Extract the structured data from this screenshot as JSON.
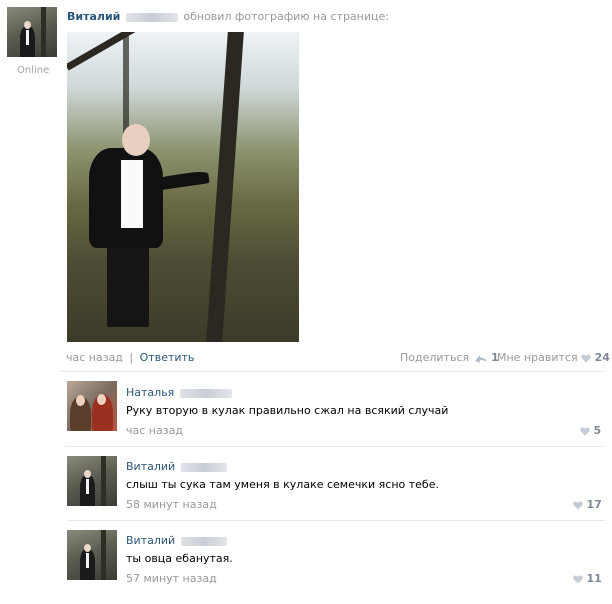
{
  "post": {
    "author_name": "Виталий",
    "action_text": "обновил фотографию на странице:",
    "status": "Online",
    "time": "час назад",
    "separator": "|",
    "reply_label": "Ответить",
    "share_label": "Поделиться",
    "share_count": "1",
    "like_label": "Мне нравится",
    "like_count": "24"
  },
  "comments": [
    {
      "author": "Наталья",
      "text": "Руку вторую в кулак правильно сжал на всякий случай",
      "time": "час назад",
      "likes": "5"
    },
    {
      "author": "Виталий",
      "text": "слыш ты сука там уменя в кулаке семечки ясно тебе.",
      "time": "58 минут назад",
      "likes": "17"
    },
    {
      "author": "Виталий",
      "text": "ты овца ебанутая.",
      "time": "57 минут назад",
      "likes": "11"
    }
  ],
  "colors": {
    "link": "#2b587a",
    "muted": "#999999",
    "divider": "#e7eaed"
  }
}
